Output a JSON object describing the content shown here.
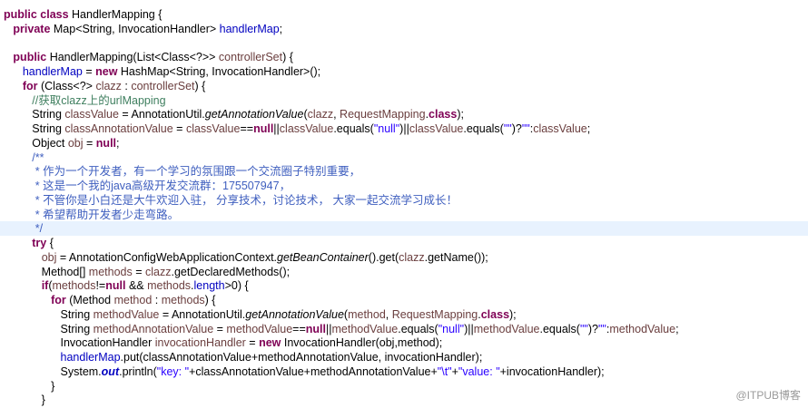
{
  "editor": {
    "lines": [
      [
        [
          "kw",
          "public class "
        ],
        [
          "",
          "HandlerMapping {"
        ]
      ],
      [
        [
          "",
          "   "
        ],
        [
          "kw",
          "private "
        ],
        [
          "",
          "Map<String, InvocationHandler> "
        ],
        [
          "fld",
          "handlerMap"
        ],
        [
          "",
          ";"
        ]
      ],
      [],
      [
        [
          "",
          "   "
        ],
        [
          "kw",
          "public "
        ],
        [
          "",
          "HandlerMapping(List<Class<?>> "
        ],
        [
          "var",
          "controllerSet"
        ],
        [
          "",
          ") {"
        ]
      ],
      [
        [
          "",
          "      "
        ],
        [
          "fld",
          "handlerMap"
        ],
        [
          "",
          " = "
        ],
        [
          "kw",
          "new "
        ],
        [
          "",
          "HashMap<String, InvocationHandler>();"
        ]
      ],
      [
        [
          "",
          "      "
        ],
        [
          "kw",
          "for "
        ],
        [
          "",
          "(Class<?> "
        ],
        [
          "var",
          "clazz"
        ],
        [
          "",
          " : "
        ],
        [
          "var",
          "controllerSet"
        ],
        [
          "",
          ") {"
        ]
      ],
      [
        [
          "",
          "         "
        ],
        [
          "cmt",
          "//获取clazz上的urlMapping"
        ]
      ],
      [
        [
          "",
          "         String "
        ],
        [
          "var",
          "classValue"
        ],
        [
          "",
          " = AnnotationUtil."
        ],
        [
          "stat",
          "getAnnotationValue"
        ],
        [
          "",
          "("
        ],
        [
          "var",
          "clazz"
        ],
        [
          "",
          ", "
        ],
        [
          "var",
          "RequestMapping"
        ],
        [
          "",
          "."
        ],
        [
          "kw",
          "class"
        ],
        [
          "",
          ");"
        ]
      ],
      [
        [
          "",
          "         String "
        ],
        [
          "var",
          "classAnnotationValue"
        ],
        [
          "",
          " = "
        ],
        [
          "var",
          "classValue"
        ],
        [
          "",
          "=="
        ],
        [
          "kw",
          "null"
        ],
        [
          "",
          "||"
        ],
        [
          "var",
          "classValue"
        ],
        [
          "",
          ".equals("
        ],
        [
          "str",
          "\"null\""
        ],
        [
          "",
          ")||"
        ],
        [
          "var",
          "classValue"
        ],
        [
          "",
          ".equals("
        ],
        [
          "str",
          "\"\""
        ],
        [
          "",
          ")?"
        ],
        [
          "str",
          "\"\""
        ],
        [
          "",
          ":"
        ],
        [
          "var",
          "classValue"
        ],
        [
          "",
          ";"
        ]
      ],
      [
        [
          "",
          "         Object "
        ],
        [
          "var",
          "obj"
        ],
        [
          "",
          " = "
        ],
        [
          "kw",
          "null"
        ],
        [
          "",
          ";"
        ]
      ],
      [
        [
          "",
          "         "
        ],
        [
          "doc",
          "/**"
        ]
      ],
      [
        [
          "",
          "          "
        ],
        [
          "doc",
          "* 作为一个开发者，有一个学习的氛围跟一个交流圈子特别重要，"
        ]
      ],
      [
        [
          "",
          "          "
        ],
        [
          "doc",
          "* 这是一个我的java高级开发交流群：175507947，"
        ]
      ],
      [
        [
          "",
          "          "
        ],
        [
          "doc",
          "* 不管你是小白还是大牛欢迎入驻， 分享技术，讨论技术， 大家一起交流学习成长！"
        ]
      ],
      [
        [
          "",
          "          "
        ],
        [
          "doc",
          "* 希望帮助开发者少走弯路。"
        ]
      ],
      [
        [
          "",
          "          "
        ],
        [
          "doc",
          "*/"
        ]
      ],
      [
        [
          "",
          "         "
        ],
        [
          "kw",
          "try "
        ],
        [
          "",
          "{"
        ]
      ],
      [
        [
          "",
          "            "
        ],
        [
          "var",
          "obj"
        ],
        [
          "",
          " = AnnotationConfigWebApplicationContext."
        ],
        [
          "stat",
          "getBeanContainer"
        ],
        [
          "",
          "().get("
        ],
        [
          "var",
          "clazz"
        ],
        [
          "",
          ".getName());"
        ]
      ],
      [
        [
          "",
          "            Method[] "
        ],
        [
          "var",
          "methods"
        ],
        [
          "",
          " = "
        ],
        [
          "var",
          "clazz"
        ],
        [
          "",
          ".getDeclaredMethods();"
        ]
      ],
      [
        [
          "",
          "            "
        ],
        [
          "kw",
          "if"
        ],
        [
          "",
          "("
        ],
        [
          "var",
          "methods"
        ],
        [
          "",
          "!="
        ],
        [
          "kw",
          "null "
        ],
        [
          "",
          "&& "
        ],
        [
          "var",
          "methods"
        ],
        [
          "",
          "."
        ],
        [
          "fld",
          "length"
        ],
        [
          "",
          ">0) {"
        ]
      ],
      [
        [
          "",
          "               "
        ],
        [
          "kw",
          "for "
        ],
        [
          "",
          "(Method "
        ],
        [
          "var",
          "method"
        ],
        [
          "",
          " : "
        ],
        [
          "var",
          "methods"
        ],
        [
          "",
          ") {"
        ]
      ],
      [
        [
          "",
          "                  String "
        ],
        [
          "var",
          "methodValue"
        ],
        [
          "",
          " = AnnotationUtil."
        ],
        [
          "stat",
          "getAnnotationValue"
        ],
        [
          "",
          "("
        ],
        [
          "var",
          "method"
        ],
        [
          "",
          ", "
        ],
        [
          "var",
          "RequestMapping"
        ],
        [
          "",
          "."
        ],
        [
          "kw",
          "class"
        ],
        [
          "",
          ");"
        ]
      ],
      [
        [
          "",
          "                  String "
        ],
        [
          "var",
          "methodAnnotationValue"
        ],
        [
          "",
          " = "
        ],
        [
          "var",
          "methodValue"
        ],
        [
          "",
          "=="
        ],
        [
          "kw",
          "null"
        ],
        [
          "",
          "||"
        ],
        [
          "var",
          "methodValue"
        ],
        [
          "",
          ".equals("
        ],
        [
          "str",
          "\"null\""
        ],
        [
          "",
          ")||"
        ],
        [
          "var",
          "methodValue"
        ],
        [
          "",
          ".equals("
        ],
        [
          "str",
          "\"\""
        ],
        [
          "",
          ")?"
        ],
        [
          "str",
          "\"\""
        ],
        [
          "",
          ":"
        ],
        [
          "var",
          "methodValue"
        ],
        [
          "",
          ";"
        ]
      ],
      [
        [
          "",
          "                  InvocationHandler "
        ],
        [
          "var",
          "invocationHandler"
        ],
        [
          "",
          " = "
        ],
        [
          "kw",
          "new "
        ],
        [
          "",
          "InvocationHandler(obj,method);"
        ]
      ],
      [
        [
          "",
          "                  "
        ],
        [
          "fld",
          "handlerMap"
        ],
        [
          "",
          ".put(classAnnotationValue+methodAnnotationValue, invocationHandler);"
        ]
      ],
      [
        [
          "",
          "                  System."
        ],
        [
          "statfld",
          "out"
        ],
        [
          "",
          ".println("
        ],
        [
          "str",
          "\"key: \""
        ],
        [
          "",
          "+classAnnotationValue+methodAnnotationValue+"
        ],
        [
          "str",
          "\"\\t\""
        ],
        [
          "",
          "+"
        ],
        [
          "str",
          "\"value: \""
        ],
        [
          "",
          "+invocationHandler);"
        ]
      ],
      [
        [
          "",
          "               }"
        ]
      ],
      [
        [
          "",
          "            }"
        ]
      ]
    ],
    "highlighted_line": 15
  },
  "watermark": "@ITPUB博客"
}
